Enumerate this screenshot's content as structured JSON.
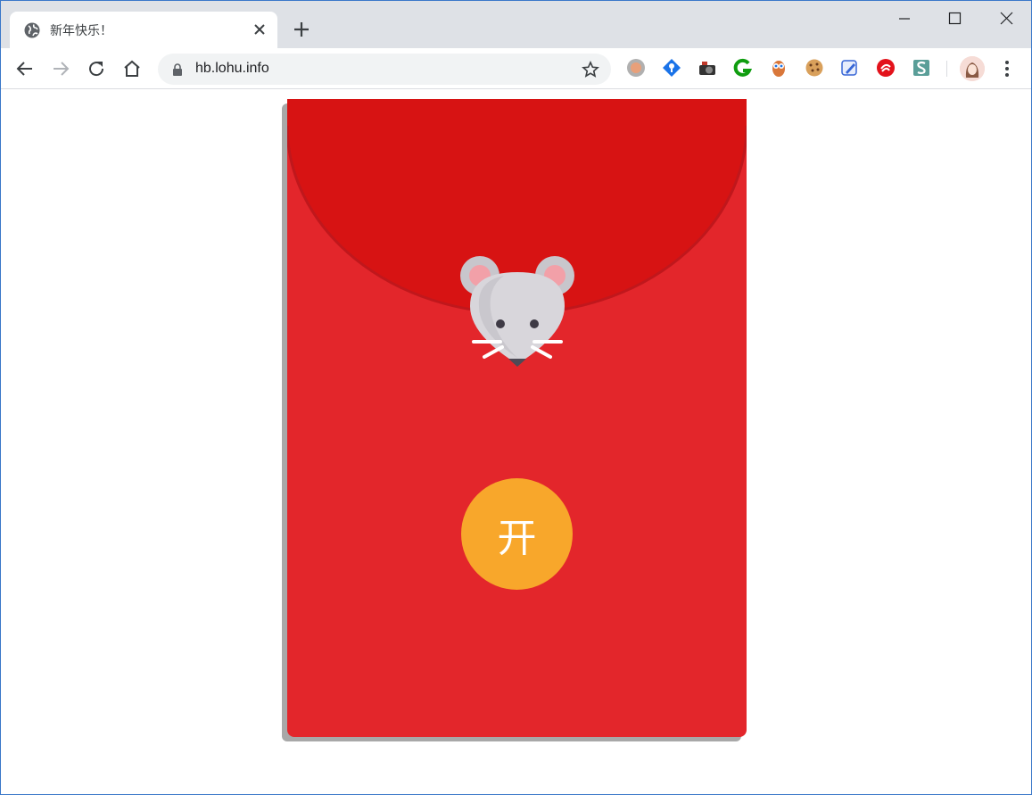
{
  "tab": {
    "title": "新年快乐！"
  },
  "address_bar": {
    "url": "hb.lohu.info"
  },
  "extensions": [
    "gray-circle-icon",
    "diamond-pin-icon",
    "camera-icon",
    "green-g-icon",
    "owl-icon",
    "cookie-icon",
    "pen-icon",
    "red-circle-icon",
    "s-icon"
  ],
  "envelope": {
    "button_label": "开",
    "colors": {
      "body": "#e3262b",
      "flap": "#d71313",
      "button": "#f8a72b",
      "shadow": "#a8a8a8"
    }
  }
}
